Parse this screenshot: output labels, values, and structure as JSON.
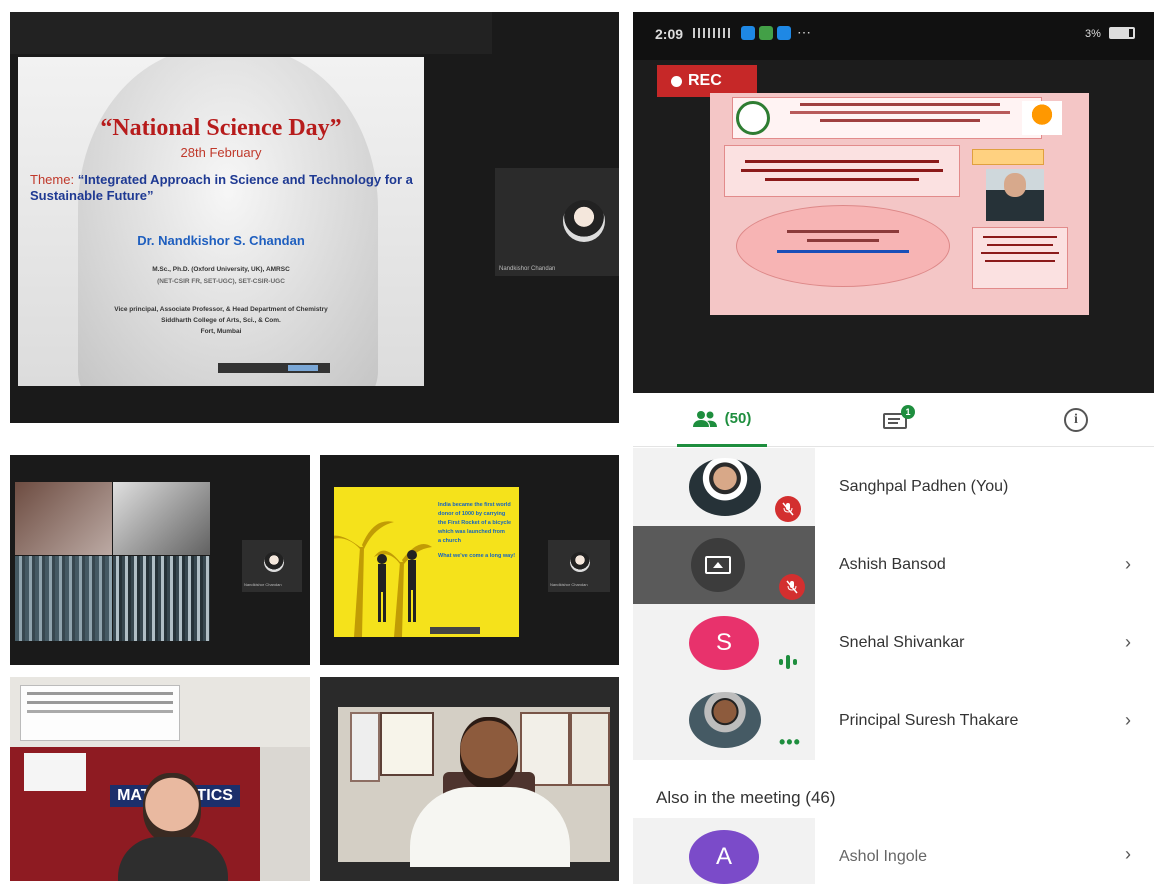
{
  "slide": {
    "title": "“National Science Day”",
    "date": "28th February",
    "theme_label": "Theme:",
    "theme_text": "“Integrated Approach in Science and Technology for a Sustainable Future”",
    "speaker": "Dr. Nandkishor S. Chandan",
    "degrees": "M.Sc., Ph.D. (Oxford University, UK), AMRSC",
    "line2": "(NET-CSIR FR, SET-UGC), SET-CSIR-UGC",
    "role": "Vice principal, Associate Professor, & Head Department of Chemistry",
    "college": "Siddharth College of Arts, Sci., & Com.",
    "city": "Fort, Mumbai"
  },
  "speaker_thumb": {
    "name": "Nandkishor Chandan"
  },
  "small_thumb_name": "Nandkishor Chandan",
  "poster_slide": {
    "lines": [
      "India became the first world",
      "donor of 1000 by carrying",
      "the First Rocket of a bicycle",
      "which was launched from",
      "a church",
      "What we've come a long way!"
    ]
  },
  "lecture_strip": {
    "label": "MATHEMATICS"
  },
  "status_bar": {
    "time": "2:09",
    "right": "3%"
  },
  "recording": {
    "label": "REC"
  },
  "tabs": {
    "people_count": "(50)",
    "chat_badge": "1"
  },
  "colors": {
    "accent_green": "#1e8e3e",
    "rec_red": "#c62828",
    "mute_red": "#d32f2f",
    "avatar_pink": "#e8326c",
    "avatar_purple": "#7b4bc9"
  },
  "participants": [
    {
      "name": "Sanghpal Padhen (You)",
      "avatar": "photo",
      "status": "muted"
    },
    {
      "name": "Ashish Bansod",
      "avatar": "screen-present-icon",
      "status": "muted"
    },
    {
      "name": "Snehal Shivankar",
      "avatar": "S",
      "status": "speaking"
    },
    {
      "name": "Principal Suresh Thakare",
      "avatar": "photo",
      "status": "more"
    }
  ],
  "also_in_meeting": {
    "label": "Also in the meeting (46)",
    "first": {
      "name": "Ashol Ingole",
      "avatar": "A"
    }
  }
}
